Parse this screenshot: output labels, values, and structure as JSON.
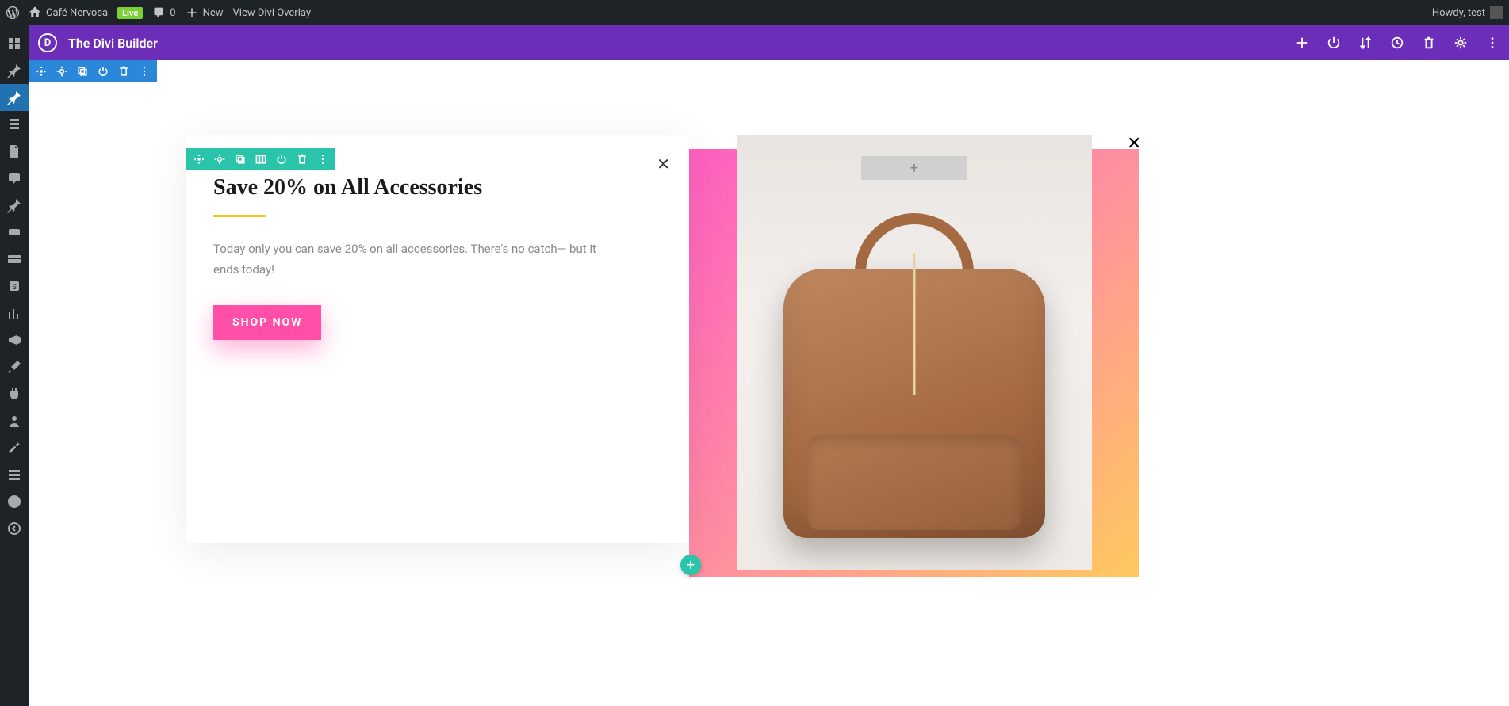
{
  "wp_bar": {
    "site_name": "Café Nervosa",
    "live": "Live",
    "comments": "0",
    "new": "New",
    "view_overlay": "View Divi Overlay",
    "howdy": "Howdy, test"
  },
  "divi": {
    "title": "The Divi Builder",
    "logo_letter": "D"
  },
  "content": {
    "heading": "Save 20% on All Accessories",
    "body": "Today only you can save 20% on all accessories. There's no catch— but it ends today!",
    "cta": "SHOP NOW",
    "close": "✕",
    "close2": "✕",
    "add_plus": "+",
    "circle_plus": "+"
  }
}
